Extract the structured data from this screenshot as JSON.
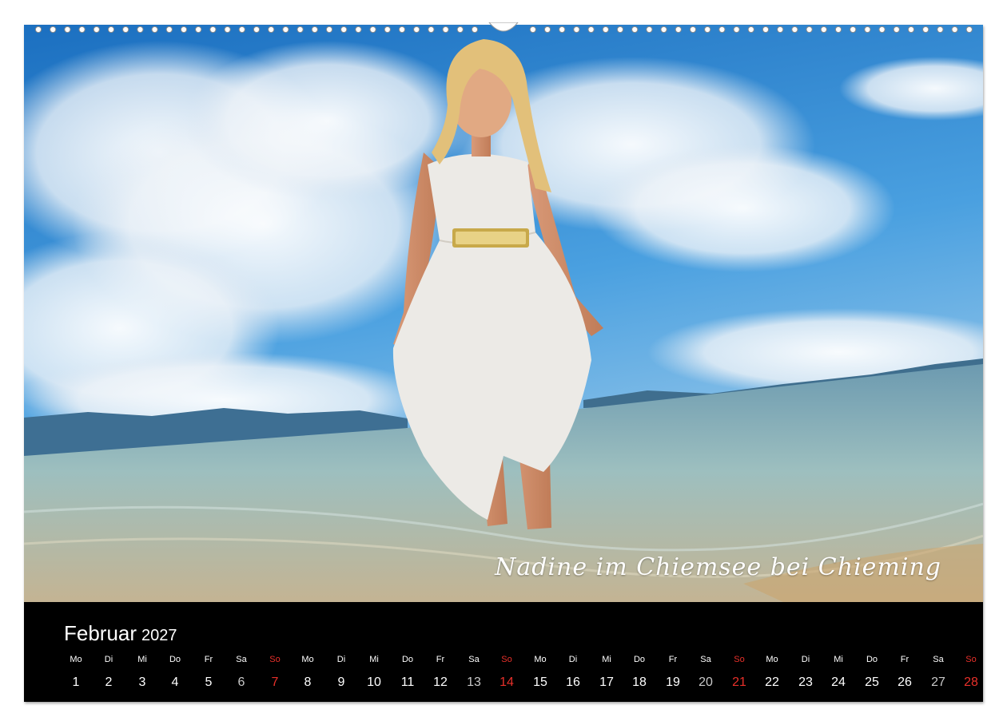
{
  "photo": {
    "caption": "Nadine im Chiemsee bei Chieming"
  },
  "calendar": {
    "month": "Februar",
    "year": "2027",
    "days": [
      {
        "dow": "Mo",
        "day": "1",
        "type": "weekday"
      },
      {
        "dow": "Di",
        "day": "2",
        "type": "weekday"
      },
      {
        "dow": "Mi",
        "day": "3",
        "type": "weekday"
      },
      {
        "dow": "Do",
        "day": "4",
        "type": "weekday"
      },
      {
        "dow": "Fr",
        "day": "5",
        "type": "weekday"
      },
      {
        "dow": "Sa",
        "day": "6",
        "type": "sat"
      },
      {
        "dow": "So",
        "day": "7",
        "type": "sun"
      },
      {
        "dow": "Mo",
        "day": "8",
        "type": "weekday"
      },
      {
        "dow": "Di",
        "day": "9",
        "type": "weekday"
      },
      {
        "dow": "Mi",
        "day": "10",
        "type": "weekday"
      },
      {
        "dow": "Do",
        "day": "11",
        "type": "weekday"
      },
      {
        "dow": "Fr",
        "day": "12",
        "type": "weekday"
      },
      {
        "dow": "Sa",
        "day": "13",
        "type": "sat"
      },
      {
        "dow": "So",
        "day": "14",
        "type": "sun"
      },
      {
        "dow": "Mo",
        "day": "15",
        "type": "weekday"
      },
      {
        "dow": "Di",
        "day": "16",
        "type": "weekday"
      },
      {
        "dow": "Mi",
        "day": "17",
        "type": "weekday"
      },
      {
        "dow": "Do",
        "day": "18",
        "type": "weekday"
      },
      {
        "dow": "Fr",
        "day": "19",
        "type": "weekday"
      },
      {
        "dow": "Sa",
        "day": "20",
        "type": "sat"
      },
      {
        "dow": "So",
        "day": "21",
        "type": "sun"
      },
      {
        "dow": "Mo",
        "day": "22",
        "type": "weekday"
      },
      {
        "dow": "Di",
        "day": "23",
        "type": "weekday"
      },
      {
        "dow": "Mi",
        "day": "24",
        "type": "weekday"
      },
      {
        "dow": "Do",
        "day": "25",
        "type": "weekday"
      },
      {
        "dow": "Fr",
        "day": "26",
        "type": "weekday"
      },
      {
        "dow": "Sa",
        "day": "27",
        "type": "sat"
      },
      {
        "dow": "So",
        "day": "28",
        "type": "sun"
      }
    ]
  },
  "colors": {
    "sunday": "#e8302a",
    "weekday": "#ffffff",
    "saturday": "#c9c9c9",
    "calendar_background": "#000000",
    "sky_top": "#1f77c6",
    "lake": "#8fb5b8"
  }
}
